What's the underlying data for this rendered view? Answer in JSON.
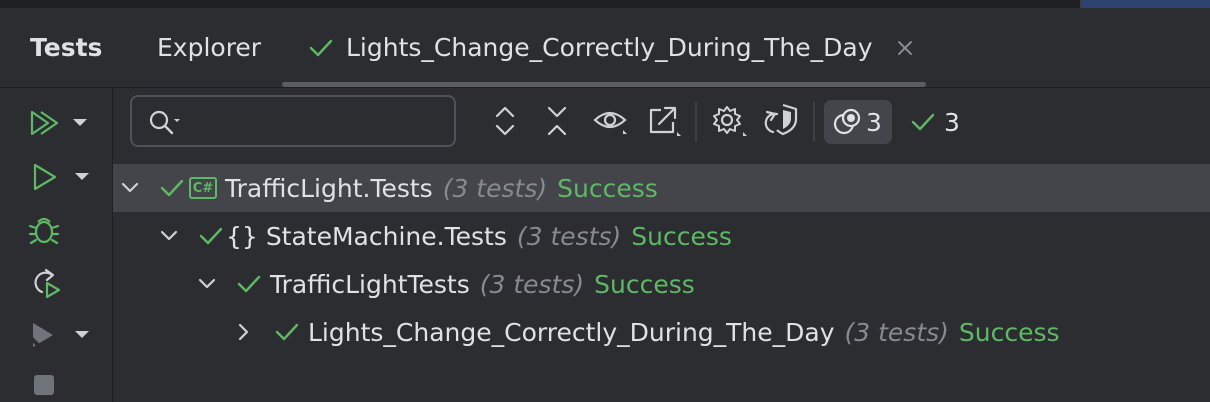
{
  "tabs": [
    {
      "label": "Tests",
      "active": false
    },
    {
      "label": "Explorer",
      "active": false
    },
    {
      "label": "Lights_Change_Correctly_During_The_Day",
      "active": true
    }
  ],
  "search": {
    "value": "",
    "placeholder": ""
  },
  "toolbar": {
    "icons": [
      "expand-all-icon",
      "collapse-all-icon",
      "show-icon",
      "export-icon",
      "settings-icon",
      "shield-refresh-icon"
    ],
    "filter_count": "3",
    "passed_count": "3"
  },
  "left_toolbar": [
    "run-all-icon",
    "run-icon",
    "debug-icon",
    "rerun-icon",
    "run-with-icon",
    "stop-icon"
  ],
  "tree": [
    {
      "name": "TrafficLight.Tests",
      "count": "(3 tests)",
      "status": "Success",
      "badge": "C#",
      "expanded": true
    },
    {
      "name": "StateMachine.Tests",
      "count": "(3 tests)",
      "status": "Success",
      "badge": "{}",
      "expanded": true
    },
    {
      "name": "TrafficLightTests",
      "count": "(3 tests)",
      "status": "Success",
      "badge": "",
      "expanded": true
    },
    {
      "name": "Lights_Change_Correctly_During_The_Day",
      "count": "(3 tests)",
      "status": "Success",
      "badge": "",
      "expanded": false
    }
  ],
  "colors": {
    "background": "#2b2d30",
    "success": "#5fb865",
    "text": "#dfe1e5",
    "muted": "#868a91",
    "selection": "#43454a"
  }
}
